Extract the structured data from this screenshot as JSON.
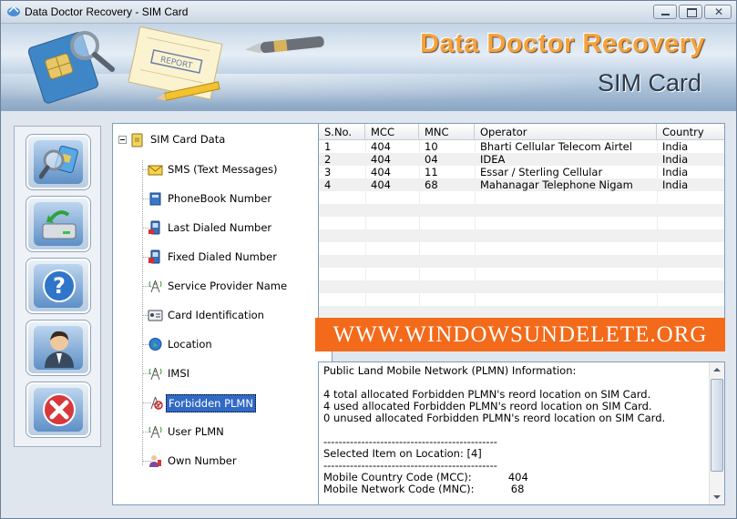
{
  "window": {
    "title": "Data Doctor Recovery - SIM Card"
  },
  "banner": {
    "title": "Data Doctor Recovery",
    "subtitle": "SIM Card",
    "report_stamp": "REPORT"
  },
  "toolbar": [
    {
      "name": "search-sim-button",
      "icon": "sim-search-icon"
    },
    {
      "name": "save-button",
      "icon": "drive-save-icon"
    },
    {
      "name": "help-button",
      "icon": "question-icon"
    },
    {
      "name": "about-button",
      "icon": "user-icon"
    },
    {
      "name": "exit-button",
      "icon": "close-icon"
    }
  ],
  "tree": {
    "root": "SIM Card Data",
    "items": [
      {
        "label": "SMS (Text Messages)",
        "icon": "envelope-icon"
      },
      {
        "label": "PhoneBook Number",
        "icon": "phonebook-icon"
      },
      {
        "label": "Last Dialed Number",
        "icon": "phone-icon"
      },
      {
        "label": "Fixed Dialed Number",
        "icon": "phone-lock-icon"
      },
      {
        "label": "Service Provider Name",
        "icon": "tower-icon"
      },
      {
        "label": "Card Identification",
        "icon": "id-card-icon"
      },
      {
        "label": "Location",
        "icon": "globe-icon"
      },
      {
        "label": "IMSI",
        "icon": "tower-icon"
      },
      {
        "label": "Forbidden PLMN",
        "icon": "tower-forbidden-icon",
        "selected": true
      },
      {
        "label": "User PLMN",
        "icon": "tower-icon"
      },
      {
        "label": "Own Number",
        "icon": "person-phone-icon"
      }
    ]
  },
  "table": {
    "headers": [
      "S.No.",
      "MCC",
      "MNC",
      "Operator",
      "Country"
    ],
    "rows": [
      [
        "1",
        "404",
        "10",
        "Bharti Cellular Telecom Airtel",
        "India"
      ],
      [
        "2",
        "404",
        "04",
        "IDEA",
        "India"
      ],
      [
        "3",
        "404",
        "11",
        "Essar / Sterling Cellular",
        "India"
      ],
      [
        "4",
        "404",
        "68",
        "Mahanagar Telephone Nigam",
        "India"
      ]
    ]
  },
  "watermark": "WWW.WINDOWSUNDELETE.ORG",
  "info": {
    "text": "Public Land Mobile Network (PLMN) Information:\n\n4 total allocated Forbidden PLMN's reord location on SIM Card.\n4 used allocated Forbidden PLMN's reord location on SIM Card.\n0 unused allocated Forbidden PLMN's reord location on SIM Card.\n\n----------------------------------------------\nSelected Item on Location: [4]\n----------------------------------------------\nMobile Country Code (MCC):           404\nMobile Network Code (MNC):           68"
  },
  "colors": {
    "accent": "#316ac5",
    "watermark_bg": "#f26a1a",
    "banner_title": "#f4a23c"
  }
}
